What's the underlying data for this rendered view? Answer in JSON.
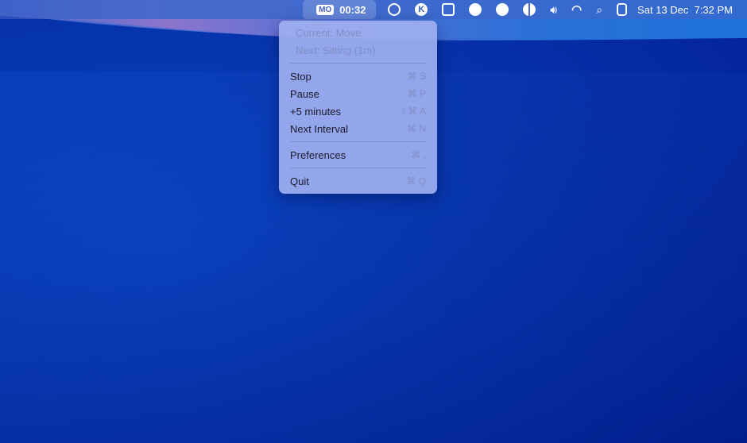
{
  "menubar": {
    "timer_badge": "MO",
    "timer_value": "00:32",
    "icons": [
      "focus-lock-icon",
      "k-app-icon",
      "grid-app-icon",
      "pen-app-icon",
      "clock-app-icon",
      "contrast-icon",
      "volume-icon",
      "wifi-icon",
      "search-icon",
      "control-center-icon"
    ],
    "datetime": "Sat 13 Dec  7:32 PM"
  },
  "menu": {
    "status": [
      "Current: Move",
      "Next: Sitting (1m)"
    ],
    "items": [
      {
        "label": "Stop",
        "shortcut": "⌘ S"
      },
      {
        "label": "Pause",
        "shortcut": "⌘ P"
      },
      {
        "label": "+5 minutes",
        "shortcut": "⇧⌘ A"
      },
      {
        "label": "Next Interval",
        "shortcut": "⌘ N"
      },
      {
        "label": "Preferences",
        "shortcut": "⌘ ,"
      },
      {
        "label": "Quit",
        "shortcut": "⌘ Q"
      }
    ]
  }
}
